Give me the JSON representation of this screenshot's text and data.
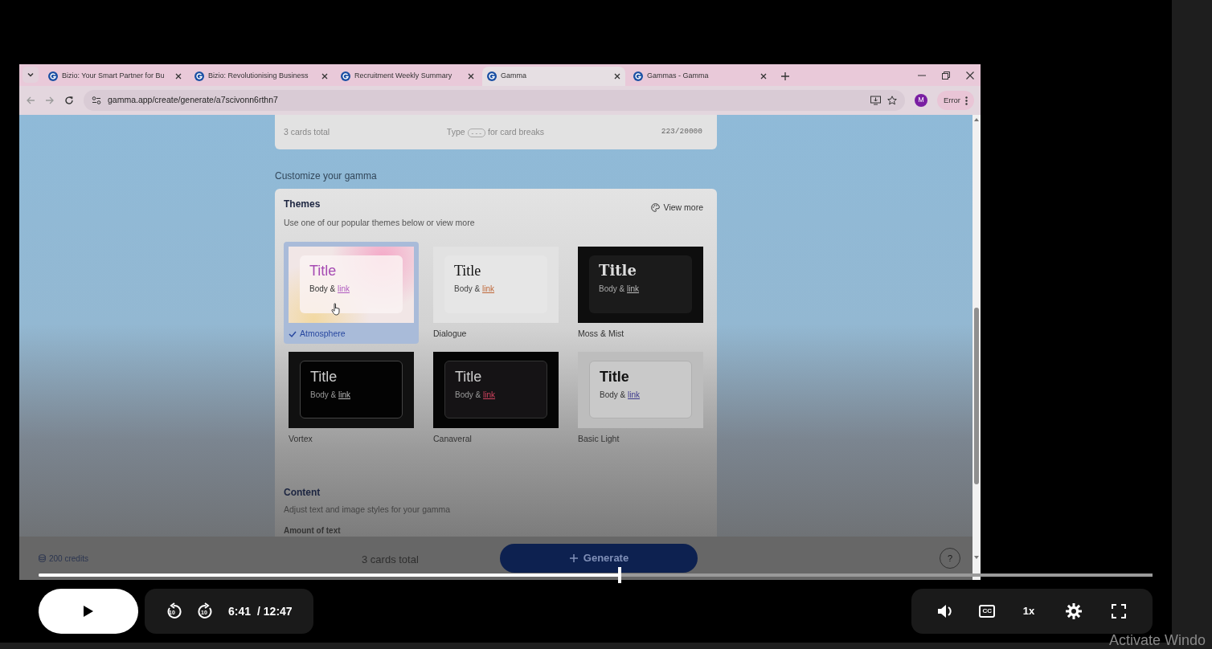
{
  "browser": {
    "tabs": [
      {
        "title": "Bizio: Your Smart Partner for Bu",
        "selected": false
      },
      {
        "title": "Bizio: Revolutionising Business",
        "selected": false
      },
      {
        "title": "Recruitment Weekly Summary",
        "selected": false
      },
      {
        "title": "Gamma",
        "selected": true
      },
      {
        "title": "Gammas - Gamma",
        "selected": false
      }
    ],
    "url": "gamma.app/create/generate/a7scivonn6rthn7",
    "profile_initial": "M",
    "status_label": "Error"
  },
  "page": {
    "summary": {
      "cards": "3 cards total",
      "hint_before": "Type",
      "hint_key": "---",
      "hint_after": "for card breaks",
      "count": "223/20000"
    },
    "section_title": "Customize your gamma",
    "themes": {
      "title": "Themes",
      "subtitle": "Use one of our popular themes below or view more",
      "view_more": "View more",
      "items": [
        {
          "name": "Atmosphere",
          "kind": "atmosphere",
          "title": "Title",
          "body": "Body &",
          "link": "link",
          "selected": true
        },
        {
          "name": "Dialogue",
          "kind": "dialogue",
          "title": "Title",
          "body": "Body &",
          "link": "link",
          "selected": false
        },
        {
          "name": "Moss & Mist",
          "kind": "moss",
          "title": "Title",
          "body": "Body &",
          "link": "link",
          "selected": false
        },
        {
          "name": "Vortex",
          "kind": "vortex",
          "title": "Title",
          "body": "Body &",
          "link": "link",
          "selected": false
        },
        {
          "name": "Canaveral",
          "kind": "canaveral",
          "title": "Title",
          "body": "Body &",
          "link": "link",
          "selected": false
        },
        {
          "name": "Basic Light",
          "kind": "basic",
          "title": "Title",
          "body": "Body &",
          "link": "link",
          "selected": false
        }
      ]
    },
    "content": {
      "title": "Content",
      "subtitle": "Adjust text and image styles for your gamma",
      "amount_label": "Amount of text"
    },
    "footer": {
      "credits": "200 credits",
      "cards": "3 cards total",
      "generate": "Generate",
      "help": "?"
    }
  },
  "player": {
    "level": 0.522,
    "playing": false,
    "rewind": "10",
    "forward": "10",
    "time": "6:41",
    "duration": "/ 12:47",
    "captions": "CC",
    "speed": "1x"
  },
  "os_notice": "Activate Windo"
}
